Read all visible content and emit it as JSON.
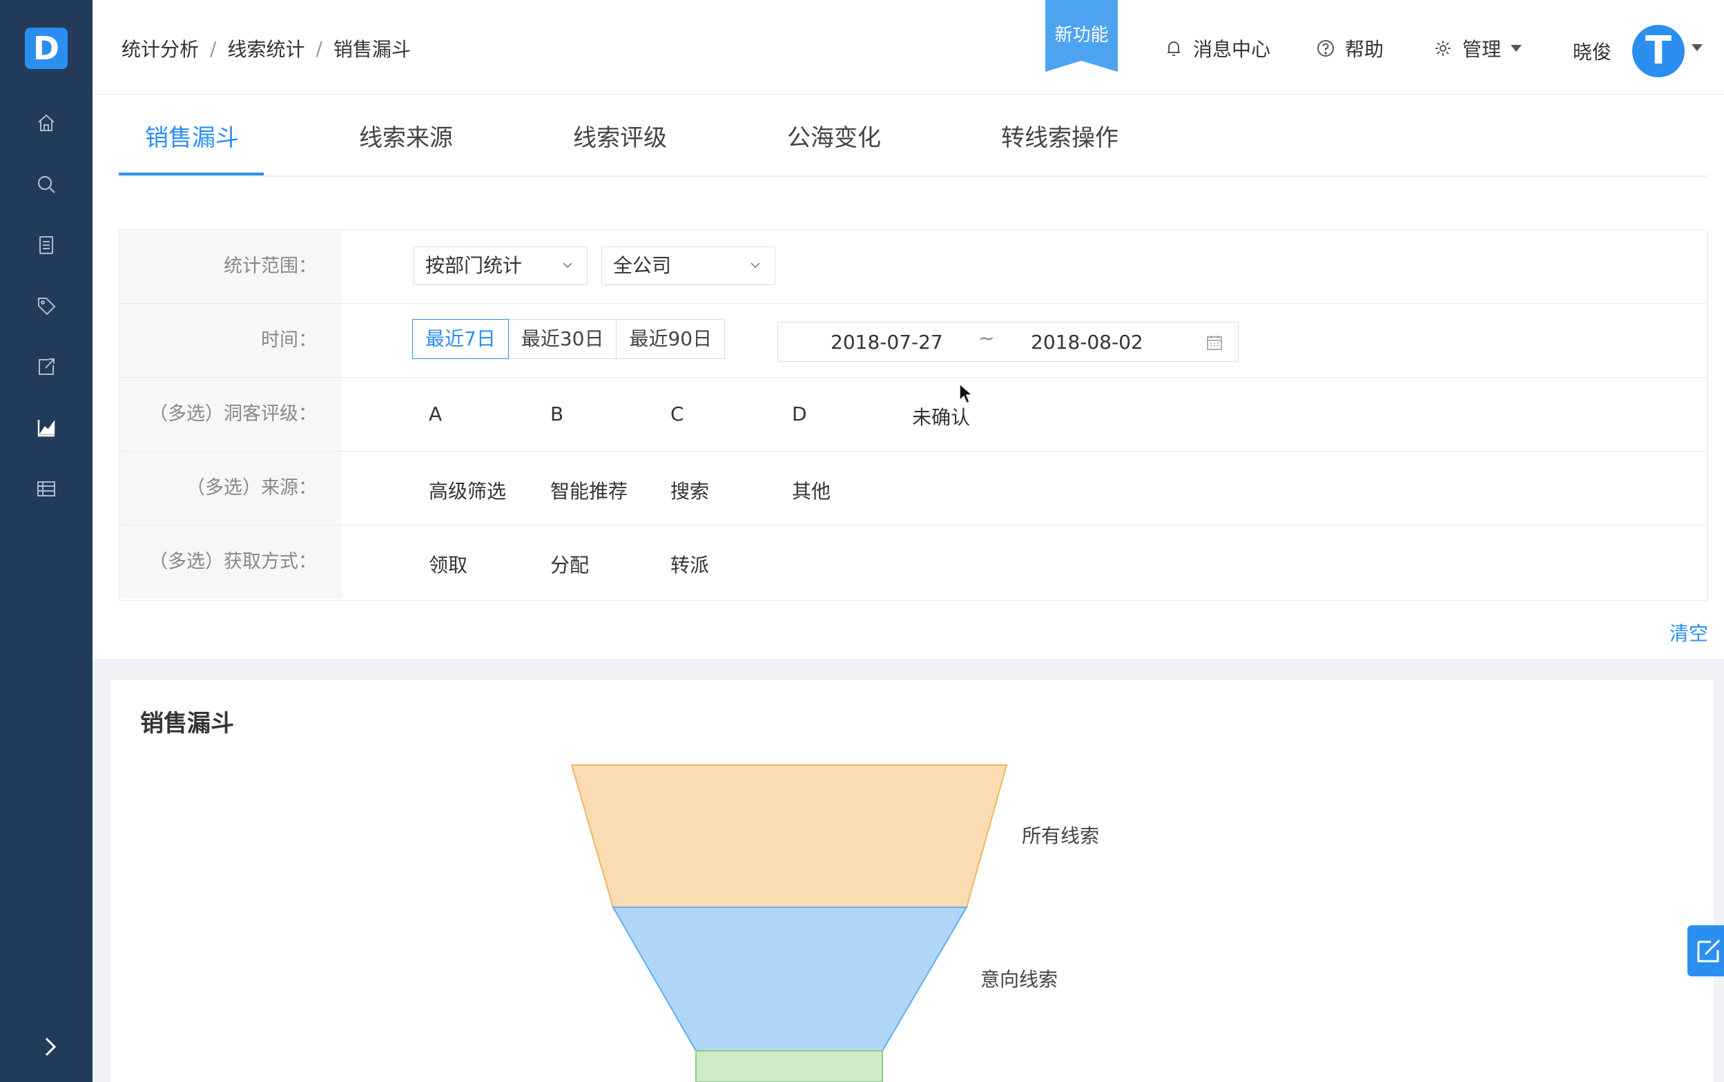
{
  "sidebar": {
    "logo": "D",
    "icons": [
      "home-icon",
      "search-icon",
      "list-icon",
      "tag-icon",
      "share-icon",
      "chart-icon",
      "table-icon"
    ],
    "color": "#233b5a"
  },
  "breadcrumb": [
    "统计分析",
    "线索统计",
    "销售漏斗"
  ],
  "breadcrumb_sep": "/",
  "header": {
    "new_feature": "新功能",
    "messages": "消息中心",
    "help": "帮助",
    "manage": "管理",
    "user": "晓俊",
    "avatar_letter": "T"
  },
  "tabs": [
    {
      "label": "销售漏斗",
      "active": true
    },
    {
      "label": "线索来源"
    },
    {
      "label": "线索评级"
    },
    {
      "label": "公海变化"
    },
    {
      "label": "转线索操作"
    }
  ],
  "filters": {
    "scope": {
      "label": "统计范围：",
      "select1": "按部门统计",
      "select2": "全公司"
    },
    "time": {
      "label": "时间：",
      "options": [
        "最近7日",
        "最近30日",
        "最近90日"
      ],
      "selected": "最近7日",
      "start": "2018-07-27",
      "tilde": "~",
      "end": "2018-08-02"
    },
    "rating": {
      "label": "（多选）洞客评级：",
      "options": [
        "A",
        "B",
        "C",
        "D",
        "未确认"
      ]
    },
    "source": {
      "label": "（多选）来源：",
      "options": [
        "高级筛选",
        "智能推荐",
        "搜索",
        "其他"
      ]
    },
    "acquire": {
      "label": "（多选）获取方式：",
      "options": [
        "领取",
        "分配",
        "转派"
      ]
    },
    "clear": "清空"
  },
  "chart_data": {
    "type": "funnel",
    "title": "销售漏斗",
    "stages": [
      {
        "name": "所有线索",
        "color": "#fbdcb2"
      },
      {
        "name": "意向线索",
        "color": "#b0d6f7"
      },
      {
        "name": "",
        "color": "#cfeac9"
      }
    ]
  },
  "colors": {
    "accent": "#2b8ff0"
  }
}
